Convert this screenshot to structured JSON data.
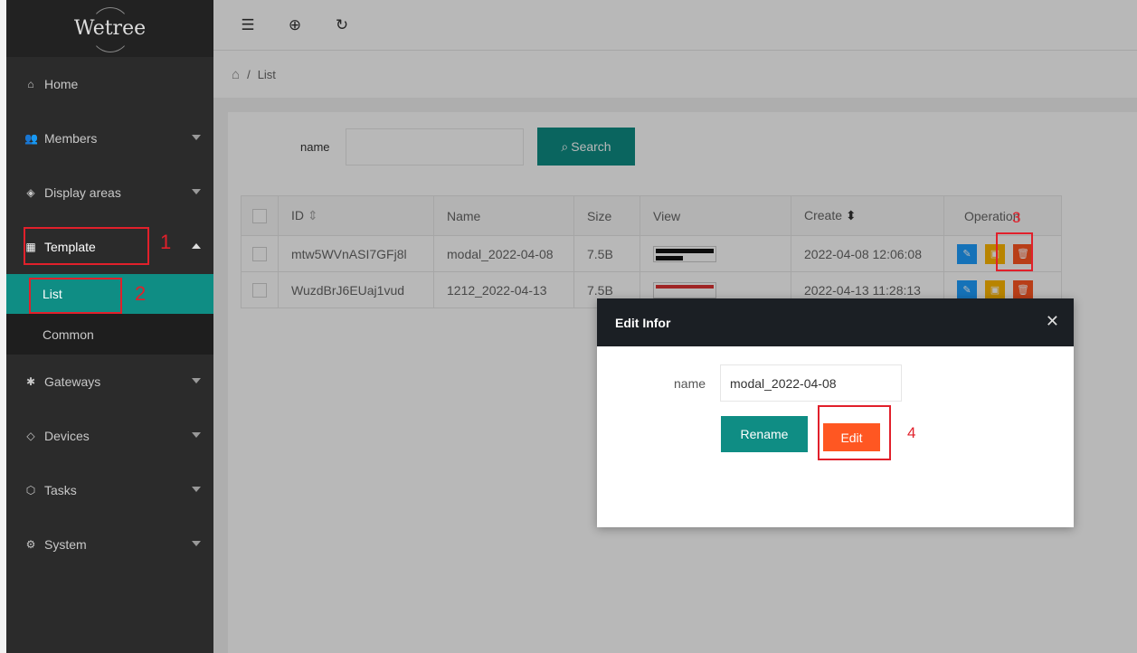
{
  "sidebar": {
    "logo": "Wetree",
    "items": [
      {
        "label": "Home",
        "icon": "home-icon"
      },
      {
        "label": "Members",
        "icon": "users-icon"
      },
      {
        "label": "Display areas",
        "icon": "layers-icon"
      },
      {
        "label": "Template",
        "icon": "template-icon"
      },
      {
        "label": "Gateways",
        "icon": "gateway-icon"
      },
      {
        "label": "Devices",
        "icon": "tag-icon"
      },
      {
        "label": "Tasks",
        "icon": "cube-icon"
      },
      {
        "label": "System",
        "icon": "gear-icon"
      }
    ],
    "submenu": [
      {
        "label": "List"
      },
      {
        "label": "Common"
      }
    ]
  },
  "topbar": {
    "icons": [
      "menu-fold-icon",
      "globe-icon",
      "refresh-icon"
    ]
  },
  "breadcrumb": {
    "separator": "/",
    "current": "List"
  },
  "search": {
    "label": "name",
    "value": "",
    "button": "Search"
  },
  "table": {
    "headers": [
      "ID",
      "Name",
      "Size",
      "View",
      "Create",
      "Operation"
    ],
    "rows": [
      {
        "id": "mtw5WVnASI7GFj8l",
        "name": "modal_2022-04-08",
        "size": "7.5B",
        "create": "2022-04-08 12:06:08"
      },
      {
        "id": "WuzdBrJ6EUaj1vud",
        "name": "1212_2022-04-13",
        "size": "7.5B",
        "create": "2022-04-13 11:28:13"
      }
    ]
  },
  "modal": {
    "title": "Edit Infor",
    "name_label": "name",
    "name_value": "modal_2022-04-08",
    "rename_button": "Rename",
    "edit_button": "Edit"
  },
  "annotations": [
    "1",
    "2",
    "3",
    "4"
  ],
  "colors": {
    "accent": "#0f8d84",
    "danger": "#ff5722",
    "warning": "#ffb800",
    "info": "#1e9fff",
    "annotation": "#e1202b"
  }
}
